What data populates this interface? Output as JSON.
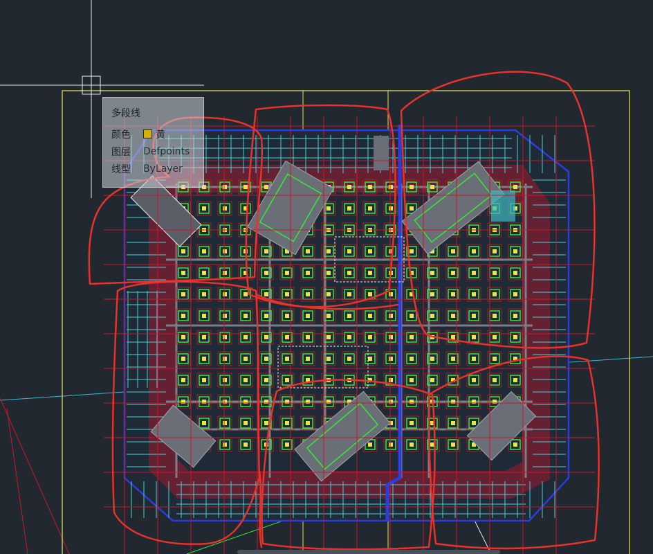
{
  "tooltip": {
    "title": "多段线",
    "rows": [
      {
        "label": "颜色",
        "value": "黄"
      },
      {
        "label": "图层",
        "value": "Defpoints"
      },
      {
        "label": "线型",
        "value": "ByLayer"
      }
    ],
    "swatch_color": "#d4b000"
  },
  "colors": {
    "background": "#212830",
    "annotation": "#e8322c",
    "yellow": "#e6e84a",
    "blue": "#2b3de0",
    "green": "#38e838",
    "cyan": "#4ad0d8",
    "magenta": "#d040d8",
    "red": "#c8182a",
    "crosshair": "#e8ecf0"
  }
}
